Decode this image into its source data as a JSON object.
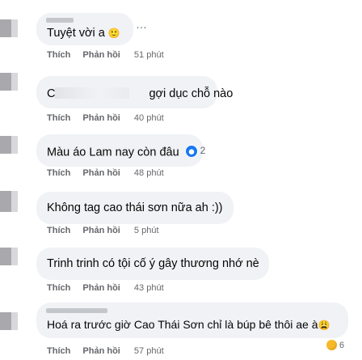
{
  "actions": {
    "like": "Thích",
    "reply": "Phản hồi"
  },
  "comments": [
    {
      "text": "Tuyệt vời a",
      "emoji": "🙂",
      "time": "51 phút"
    },
    {
      "text_prefix": "C",
      "text": "gợi dục chỗ nào",
      "time": "40 phút"
    },
    {
      "text": "Màu áo Lam nay còn đâu",
      "reaction_count": "2",
      "time": "48 phút"
    },
    {
      "text": "Không tag cao thái sơn nữa ah :))",
      "time": "5 phút"
    },
    {
      "text": "Trinh trinh có tội cố ý gây thương nhớ nè",
      "time": "43 phút"
    },
    {
      "text": "Hoá ra trước giờ Cao Thái Sơn chỉ là búp bê thôi ae à",
      "emoji": "😩",
      "reaction_count": "6",
      "time": "57 phút"
    }
  ],
  "more_icon": "…",
  "colors": {
    "bubble": "#f0f2f5",
    "meta": "#65676b",
    "like_reaction": "#1877f2",
    "haha_reaction": "#f7b928"
  }
}
